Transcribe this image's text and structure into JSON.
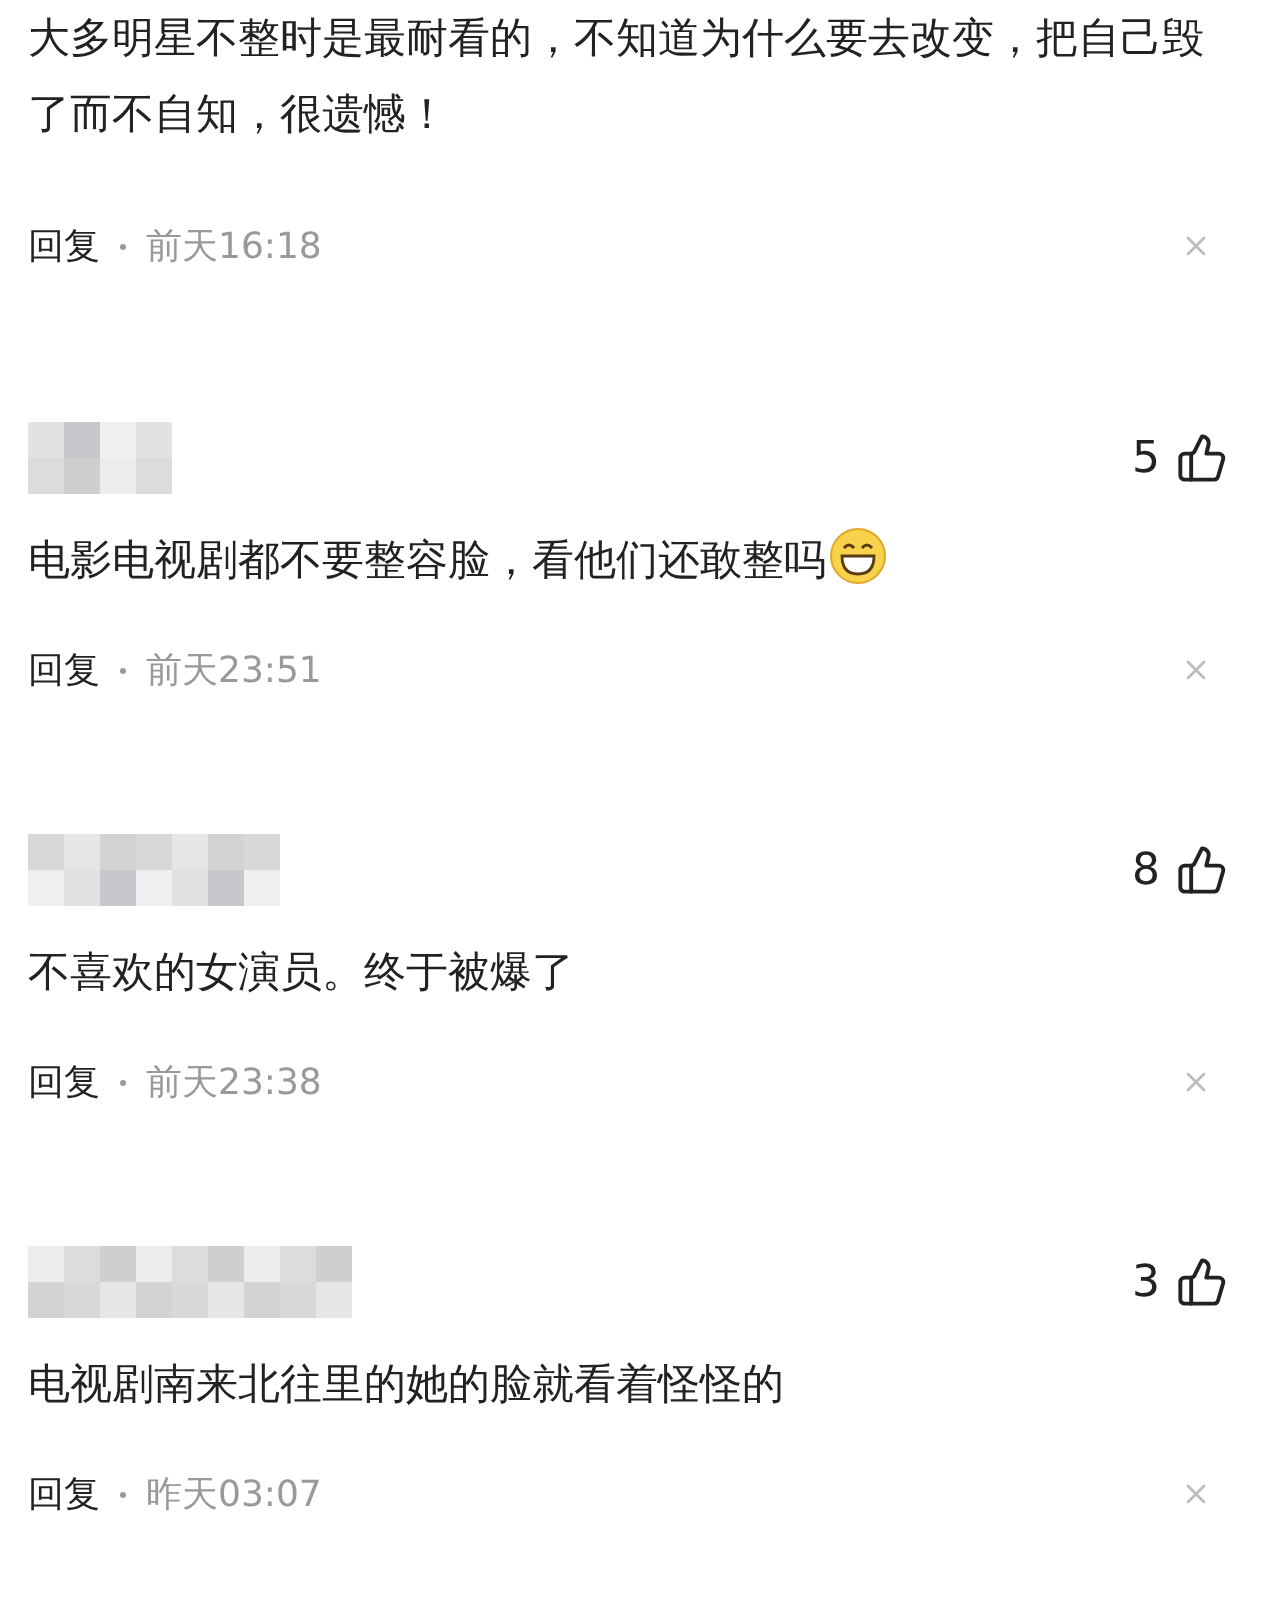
{
  "comments": [
    {
      "text": "大多明星不整时是最耐看的，不知道为什么要去改变，把自己毁了而不自知，很遗憾！",
      "reply": "回复",
      "time": "前天16:18"
    },
    {
      "likes": "5",
      "text": "电影电视剧都不要整容脸，看他们还敢整吗",
      "emoji": true,
      "reply": "回复",
      "time": "前天23:51"
    },
    {
      "likes": "8",
      "text": "不喜欢的女演员。终于被爆了",
      "emoji": false,
      "reply": "回复",
      "time": "前天23:38"
    },
    {
      "likes": "3",
      "text": "电视剧南来北往里的她的脸就看着怪怪的",
      "emoji": false,
      "reply": "回复",
      "time": "昨天03:07"
    }
  ]
}
